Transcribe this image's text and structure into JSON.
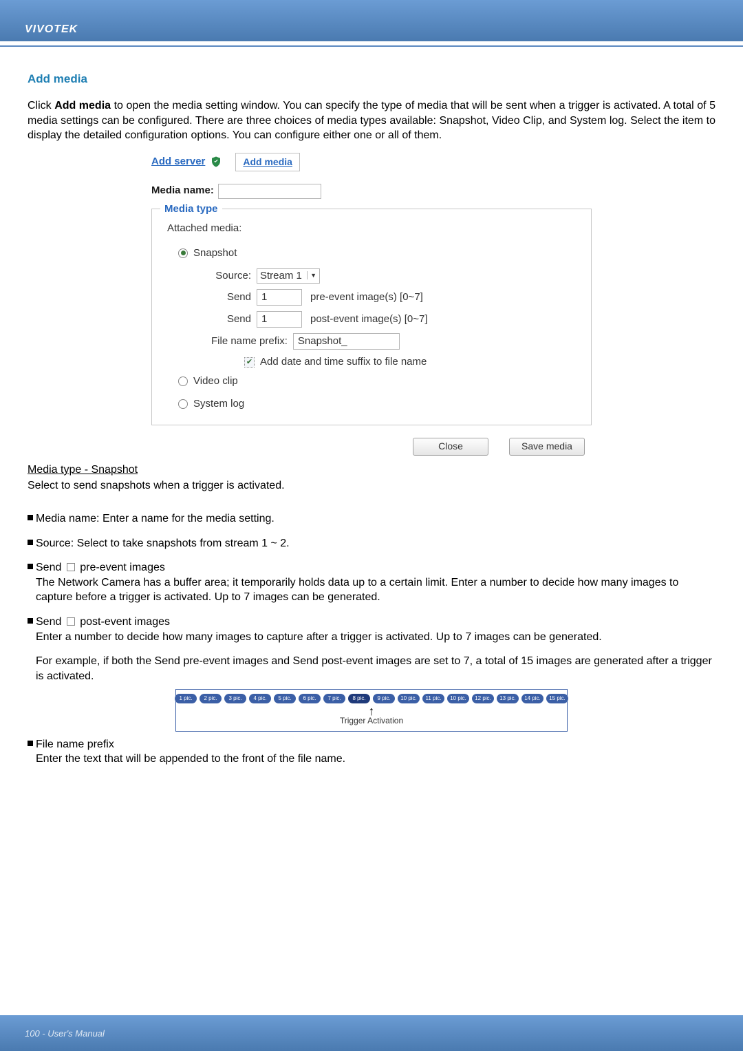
{
  "brand": "VIVOTEK",
  "section_title": "Add media",
  "intro": "Click Add media to open the media setting window. You can specify the type of media that will be sent when a trigger is activated. A total of 5 media settings can be configured. There are three choices of media types available: Snapshot, Video Clip, and System log. Select the item to display the detailed configuration options. You can configure either one or all of them.",
  "dialog": {
    "add_server": "Add server",
    "add_media": "Add media",
    "media_name_label": "Media name:",
    "legend": "Media type",
    "attached": "Attached media:",
    "snapshot": "Snapshot",
    "source_label": "Source:",
    "source_value": "Stream 1",
    "send_label": "Send",
    "pre_count": "1",
    "pre_text": "pre-event image(s) [0~7]",
    "post_count": "1",
    "post_text": "post-event image(s) [0~7]",
    "prefix_label": "File name prefix:",
    "prefix_value": "Snapshot_",
    "suffix_cb": "Add date and time suffix to file name",
    "video_clip": "Video clip",
    "system_log": "System log",
    "close_btn": "Close",
    "save_btn": "Save media"
  },
  "media_type_head": "Media type - Snapshot",
  "media_type_line": "Select to send snapshots when a trigger is activated.",
  "bullets": {
    "b1": "Media name: Enter a name for the media setting.",
    "b2": "Source: Select to take snapshots from stream 1 ~ 2.",
    "b3_head": "Send ☐ pre-event images",
    "b3_body": "The Network Camera has a buffer area; it temporarily holds data up to a certain limit. Enter a number to decide how many images to capture before a trigger is activated. Up to 7 images can be generated.",
    "b4_head": "Send ☐ post-event images",
    "b4_body": "Enter a number to decide how many images to capture after a trigger is activated. Up to 7 images can be generated.",
    "b4_ex": "For example, if both the Send pre-event images and Send post-event images are set to 7, a total of 15 images are generated after a trigger is activated.",
    "b5_head": "File name prefix",
    "b5_body": "Enter the text that will be appended to the front of the file name."
  },
  "trigger": {
    "pills": [
      "1 pic.",
      "2 pic.",
      "3 pic.",
      "4 pic.",
      "5 pic.",
      "6 pic.",
      "7 pic.",
      "8 pic.",
      "9 pic.",
      "10 pic.",
      "11 pic.",
      "10 pic.",
      "12 pic.",
      "13 pic.",
      "14 pic.",
      "15 pic."
    ],
    "active_index": 7,
    "label": "Trigger Activation"
  },
  "footer": "100 - User's Manual"
}
